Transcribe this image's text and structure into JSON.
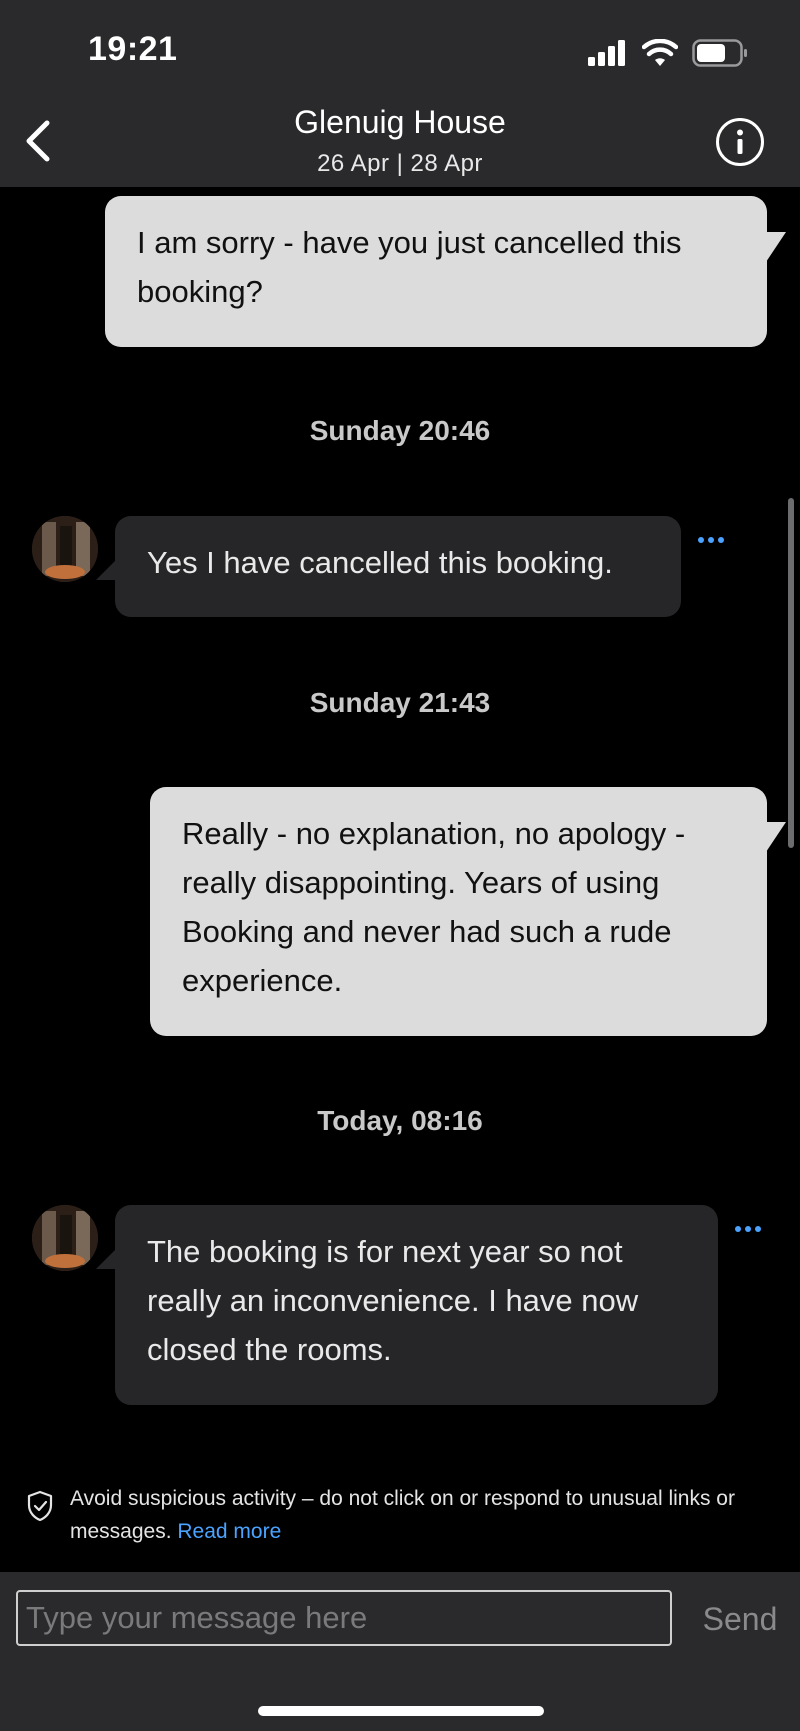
{
  "status_bar": {
    "time": "19:21"
  },
  "header": {
    "title": "Glenuig House",
    "dates": "26 Apr | 28 Apr"
  },
  "messages": [
    {
      "kind": "outgoing",
      "text": "I am sorry - have you just cancelled this booking?"
    },
    {
      "kind": "timestamp",
      "text": "Sunday 20:46"
    },
    {
      "kind": "incoming",
      "text": "Yes I have cancelled this booking."
    },
    {
      "kind": "timestamp",
      "text": "Sunday 21:43"
    },
    {
      "kind": "outgoing",
      "text": "Really - no explanation, no apology - really disappointing.  Years of using Booking and never had such a rude experience."
    },
    {
      "kind": "timestamp",
      "text": "Today, 08:16"
    },
    {
      "kind": "incoming",
      "text": "The booking is for next year so not really an inconvenience.  I have now closed the rooms."
    }
  ],
  "notice": {
    "text": "Avoid suspicious activity – do not click on or respond to unusual links or messages.",
    "link": "Read more"
  },
  "composer": {
    "placeholder": "Type your message here",
    "send_label": "Send"
  },
  "colors": {
    "accent": "#4aa3ff",
    "outgoing_bubble": "#dcdcdc",
    "incoming_bubble": "#262628",
    "bar": "#2a2a2c"
  }
}
